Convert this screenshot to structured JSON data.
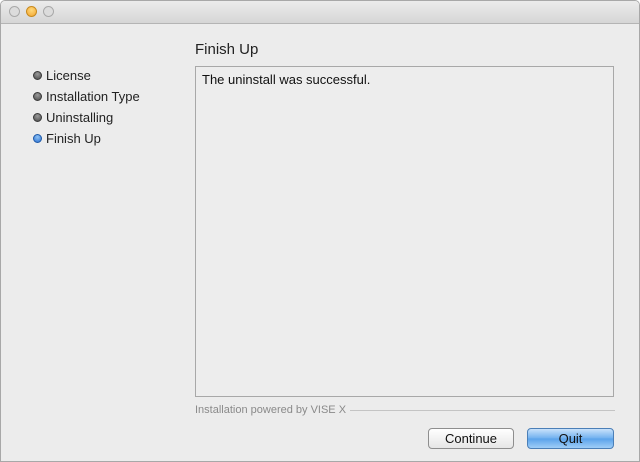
{
  "window": {
    "title": ""
  },
  "sidebar": {
    "steps": [
      {
        "label": "License",
        "state": "done"
      },
      {
        "label": "Installation Type",
        "state": "done"
      },
      {
        "label": "Uninstalling",
        "state": "done"
      },
      {
        "label": "Finish Up",
        "state": "active"
      }
    ]
  },
  "main": {
    "heading": "Finish Up",
    "message": "The uninstall was successful.",
    "powered_by": "Installation powered by VISE X"
  },
  "buttons": {
    "continue_label": "Continue",
    "quit_label": "Quit"
  },
  "colors": {
    "active_step": "#2a6fd0",
    "default_button": "#6fb0ef",
    "window_bg": "#ececec"
  }
}
